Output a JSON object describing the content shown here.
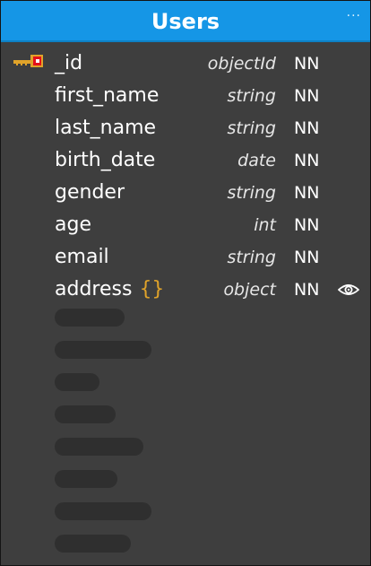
{
  "header": {
    "title": "Users",
    "more_label": "···"
  },
  "fields": [
    {
      "name": "_id",
      "type": "objectId",
      "constraint": "NN",
      "primary_key": true
    },
    {
      "name": "first_name",
      "type": "string",
      "constraint": "NN"
    },
    {
      "name": "last_name",
      "type": "string",
      "constraint": "NN"
    },
    {
      "name": "birth_date",
      "type": "date",
      "constraint": "NN"
    },
    {
      "name": "gender",
      "type": "string",
      "constraint": "NN"
    },
    {
      "name": "age",
      "type": "int",
      "constraint": "NN"
    },
    {
      "name": "email",
      "type": "string",
      "constraint": "NN"
    },
    {
      "name": "address",
      "braces": "{}",
      "type": "object",
      "constraint": "NN",
      "icon": "eye-icon"
    }
  ],
  "colors": {
    "header": "#1596e6",
    "body": "#3e3e3e",
    "braces": "#e0a32a",
    "placeholder": "#2f2f2f"
  },
  "placeholder_count": 8
}
